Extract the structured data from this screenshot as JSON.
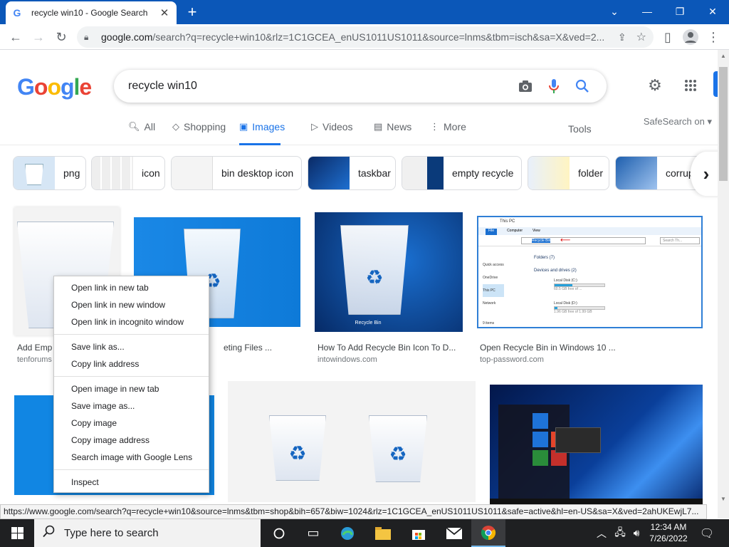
{
  "browser": {
    "tab_title": "recycle win10 - Google Search",
    "url_host": "google.com",
    "url_rest": "/search?q=recycle+win10&rlz=1C1GCEA_enUS1011US1011&source=lnms&tbm=isch&sa=X&ved=2...",
    "status_url": "https://www.google.com/search?q=recycle+win10&source=lnms&tbm=shop&bih=657&biw=1024&rlz=1C1GCEA_enUS1011US1011&safe=active&hl=en-US&sa=X&ved=2ahUKEwjL7..."
  },
  "google": {
    "logo": [
      "G",
      "o",
      "o",
      "g",
      "l",
      "e"
    ],
    "logo_colors": [
      "#4285f4",
      "#ea4335",
      "#fbbc05",
      "#4285f4",
      "#34a853",
      "#ea4335"
    ],
    "query": "recycle win10",
    "tabs": [
      {
        "label": "All",
        "icon": "search-icon"
      },
      {
        "label": "Shopping",
        "icon": "tag-icon"
      },
      {
        "label": "Images",
        "icon": "image-icon"
      },
      {
        "label": "Videos",
        "icon": "play-icon"
      },
      {
        "label": "News",
        "icon": "news-icon"
      },
      {
        "label": "More",
        "icon": "more-vert-icon"
      }
    ],
    "tools": "Tools",
    "safesearch": "SafeSearch on"
  },
  "chips": [
    "png",
    "icon",
    "bin desktop icon",
    "taskbar",
    "empty recycle",
    "folder",
    "corrupt"
  ],
  "results": [
    {
      "caption": "Add Emp",
      "source": "tenforums"
    },
    {
      "caption": "eting Files ...",
      "source": ""
    },
    {
      "caption": "How To Add Recycle Bin Icon To D...",
      "source": "intowindows.com"
    },
    {
      "caption": "Open Recycle Bin in Windows 10 ...",
      "source": "top-password.com"
    }
  ],
  "explorer_shot": {
    "title": "This PC",
    "tabs": [
      "File",
      "Computer",
      "View"
    ],
    "address": "Recycle Bin",
    "search": "Search Th...",
    "nav": [
      "Quick access",
      "OneDrive",
      "This PC",
      "Network"
    ],
    "folders": "Folders (7)",
    "drives_header": "Devices and drives (2)",
    "drives": [
      {
        "name": "Local Disk (C:)",
        "free": "60.5 GB free of ...",
        "fill": 0.35
      },
      {
        "name": "Local Disk (D:)",
        "free": "1.96 GB free of 1.99 GB",
        "fill": 0.05
      }
    ],
    "items": "9 items"
  },
  "bin_label": "Recycle Bin",
  "context_menu": [
    [
      "Open link in new tab",
      "Open link in new window",
      "Open link in incognito window"
    ],
    [
      "Save link as...",
      "Copy link address"
    ],
    [
      "Open image in new tab",
      "Save image as...",
      "Copy image",
      "Copy image address",
      "Search image with Google Lens"
    ],
    [
      "Inspect"
    ]
  ],
  "taskbar": {
    "search_placeholder": "Type here to search",
    "time": "12:34 AM",
    "date": "7/26/2022"
  },
  "colors": {
    "titlebar": "#0b57b8",
    "accent": "#1a73e8",
    "win_blue": "#0078d7"
  }
}
